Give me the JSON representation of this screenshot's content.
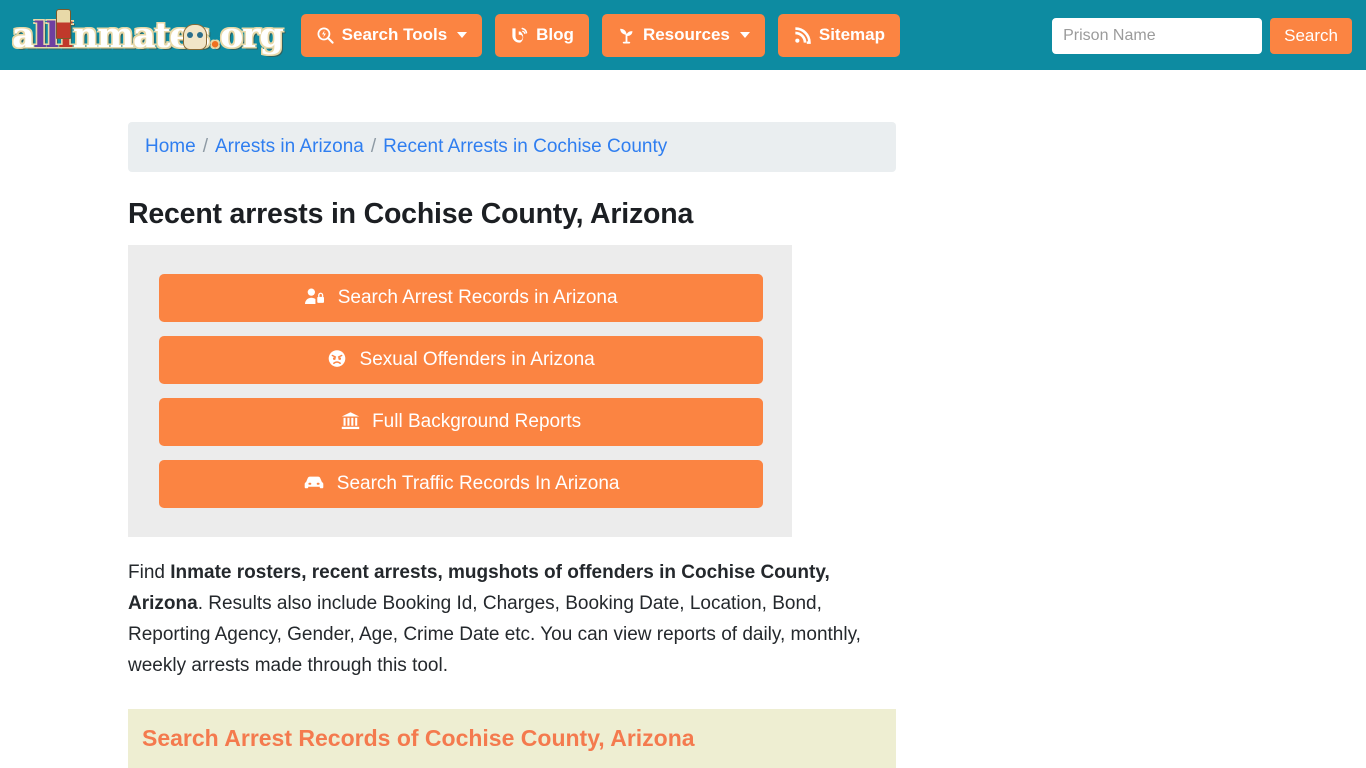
{
  "brand": {
    "logo_text": "allInmates.org",
    "logo_parts": {
      "a": "a",
      "ll": "ll",
      "i": "I",
      "rest": "nmates",
      "dot": ".",
      "o": "o",
      "rg": "rg"
    }
  },
  "colors": {
    "header_teal": "#0d8ba1",
    "accent_orange": "#fb8442",
    "panel_gray": "#ececec",
    "breadcrumb_gray": "#eaeef0",
    "band_yellow": "#eeeed2",
    "link_blue": "#2f7ef0",
    "band_title_orange": "#f47a4e"
  },
  "nav": {
    "items": [
      {
        "label": "Search Tools",
        "icon": "search-bolt-icon",
        "has_caret": true
      },
      {
        "label": "Blog",
        "icon": "blogger-icon",
        "has_caret": false
      },
      {
        "label": "Resources",
        "icon": "seedling-icon",
        "has_caret": true
      },
      {
        "label": "Sitemap",
        "icon": "rss-icon",
        "has_caret": false
      }
    ]
  },
  "search": {
    "placeholder": "Prison Name",
    "value": "",
    "button_label": "Search"
  },
  "breadcrumb": {
    "items": [
      {
        "label": "Home"
      },
      {
        "label": "Arrests in Arizona"
      },
      {
        "label": "Recent Arrests in Cochise County"
      }
    ],
    "separator": "/"
  },
  "main": {
    "title": "Recent arrests in Cochise County, Arizona",
    "action_buttons": [
      {
        "label": "Search Arrest Records in Arizona",
        "icon": "user-lock-icon"
      },
      {
        "label": "Sexual Offenders in Arizona",
        "icon": "angry-face-icon"
      },
      {
        "label": "Full Background Reports",
        "icon": "landmark-icon"
      },
      {
        "label": "Search Traffic Records In Arizona",
        "icon": "car-icon"
      }
    ],
    "intro": {
      "lead": "Find ",
      "bold": "Inmate rosters, recent arrests, mugshots of offenders in Cochise County, Arizona",
      "rest": ". Results also include Booking Id, Charges, Booking Date, Location, Bond, Reporting Agency, Gender, Age, Crime Date etc. You can view reports of daily, monthly, weekly arrests made through this tool."
    },
    "band_title": "Search Arrest Records of Cochise County, Arizona"
  }
}
